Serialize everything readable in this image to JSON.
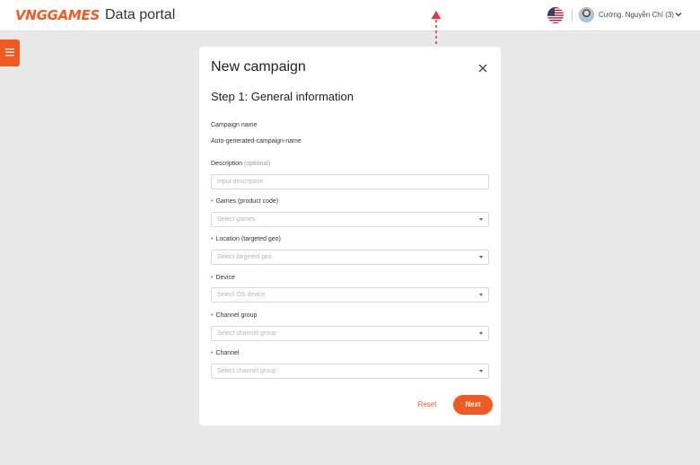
{
  "header": {
    "logo_mark": "VNGGAMES",
    "app_title": "Data portal",
    "user_name": "Cường. Nguyễn Chí (3)",
    "language_flag": "us-flag-icon",
    "brand_color": "#f15a22"
  },
  "modal": {
    "title": "New campaign",
    "step_title": "Step 1: General information",
    "fields": {
      "campaign_name": {
        "label": "Campaign name",
        "value": "Auto-generated-campaign-name"
      },
      "description": {
        "label": "Description",
        "optional": "(optional)",
        "placeholder": "Input description"
      },
      "games": {
        "label": "Games (product code)",
        "placeholder": "Select games"
      },
      "location": {
        "label": "Location (targeted geo)",
        "placeholder": "Select targeted geo"
      },
      "device": {
        "label": "Device",
        "placeholder": "Select OS device"
      },
      "channel_group": {
        "label": "Channel group",
        "placeholder": "Select channel group"
      },
      "channel": {
        "label": "Channel",
        "placeholder": "Select channel group"
      }
    },
    "reset_label": "Reset",
    "next_label": "Next"
  }
}
